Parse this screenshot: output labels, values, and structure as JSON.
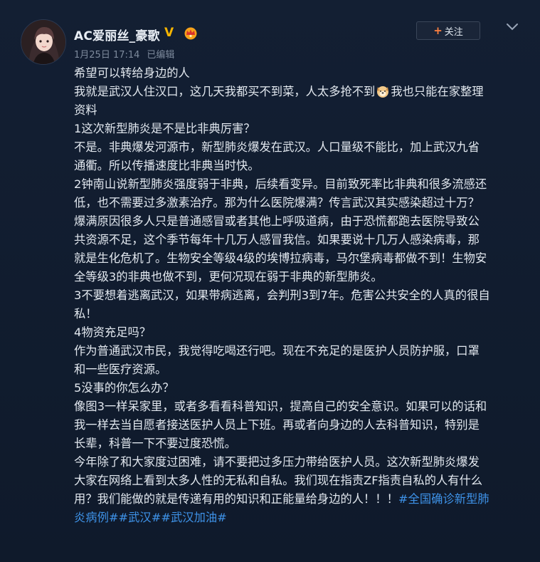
{
  "post": {
    "username": "AC爱丽丝_豪歌",
    "verified_mark": "V",
    "date": "1月25日 17:14",
    "edited": "已编辑",
    "follow_label": "关注",
    "lines": [
      "希望可以转给身边的人",
      "我就是武汉人住汉口，这几天我都买不到菜，人太多抢不到",
      "我也只能在家整理",
      "资料",
      "1这次新型肺炎是不是比非典厉害？",
      "不是。非典爆发河源市，新型肺炎爆发在武汉。人口量级不能比，加上武汉九省",
      "通衢。所以传播速度比非典当时快。",
      "2钟南山说新型肺炎强度弱于非典，后续看变异。目前致死率比非典和很多流感还",
      "低，也不需要过多激素治疗。那为什么医院爆满？传言武汉其实感染超过十万？",
      "爆满原因很多人只是普通感冒或者其他上呼吸道病，由于恐慌都跑去医院导致公",
      "共资源不足，这个季节每年十几万人感冒我信。如果要说十几万人感染病毒，那",
      "就是生化危机了。生物安全等级4级的埃博拉病毒，马尔堡病毒都做不到！生物安",
      "全等级3的非典也做不到，更何况现在弱于非典的新型肺炎。",
      "3不要想着逃离武汉，如果带病逃离，会判刑3到7年。危害公共安全的人真的很自",
      "私！",
      "4物资充足吗？",
      "作为普通武汉市民，我觉得吃喝还行吧。现在不充足的是医护人员防护服，口罩",
      "和一些医疗资源。",
      "5没事的你怎么办？",
      "像图3一样呆家里，或者多看看科普知识，提高自己的安全意识。如果可以的话和",
      "我一样去当自愿者接送医护人员上下班。再或者向身边的人去科普知识，特别是",
      "长辈，科普一下不要过度恐慌。",
      "今年除了和大家度过困难，请不要把过多压力带给医护人员。这次新型肺炎爆发",
      "大家在网络上看到太多人性的无私和自私。我们现在指责ZF指责自私的人有什么",
      "用？我们能做的就是传递有用的知识和正能量给身边的人！！！",
      "炎病例#",
      "#武汉#",
      "#武汉加油#"
    ],
    "hashtag_1_start": "#全国确诊新型肺",
    "icons": [
      "crown-icon",
      "dog-emoji-icon",
      "chevron-down-icon",
      "plus-icon"
    ],
    "colors": {
      "hashtag": "#3e92e8",
      "verified": "#f7b500",
      "follow_plus": "#ff8140",
      "background": "#0f1a2b"
    }
  }
}
